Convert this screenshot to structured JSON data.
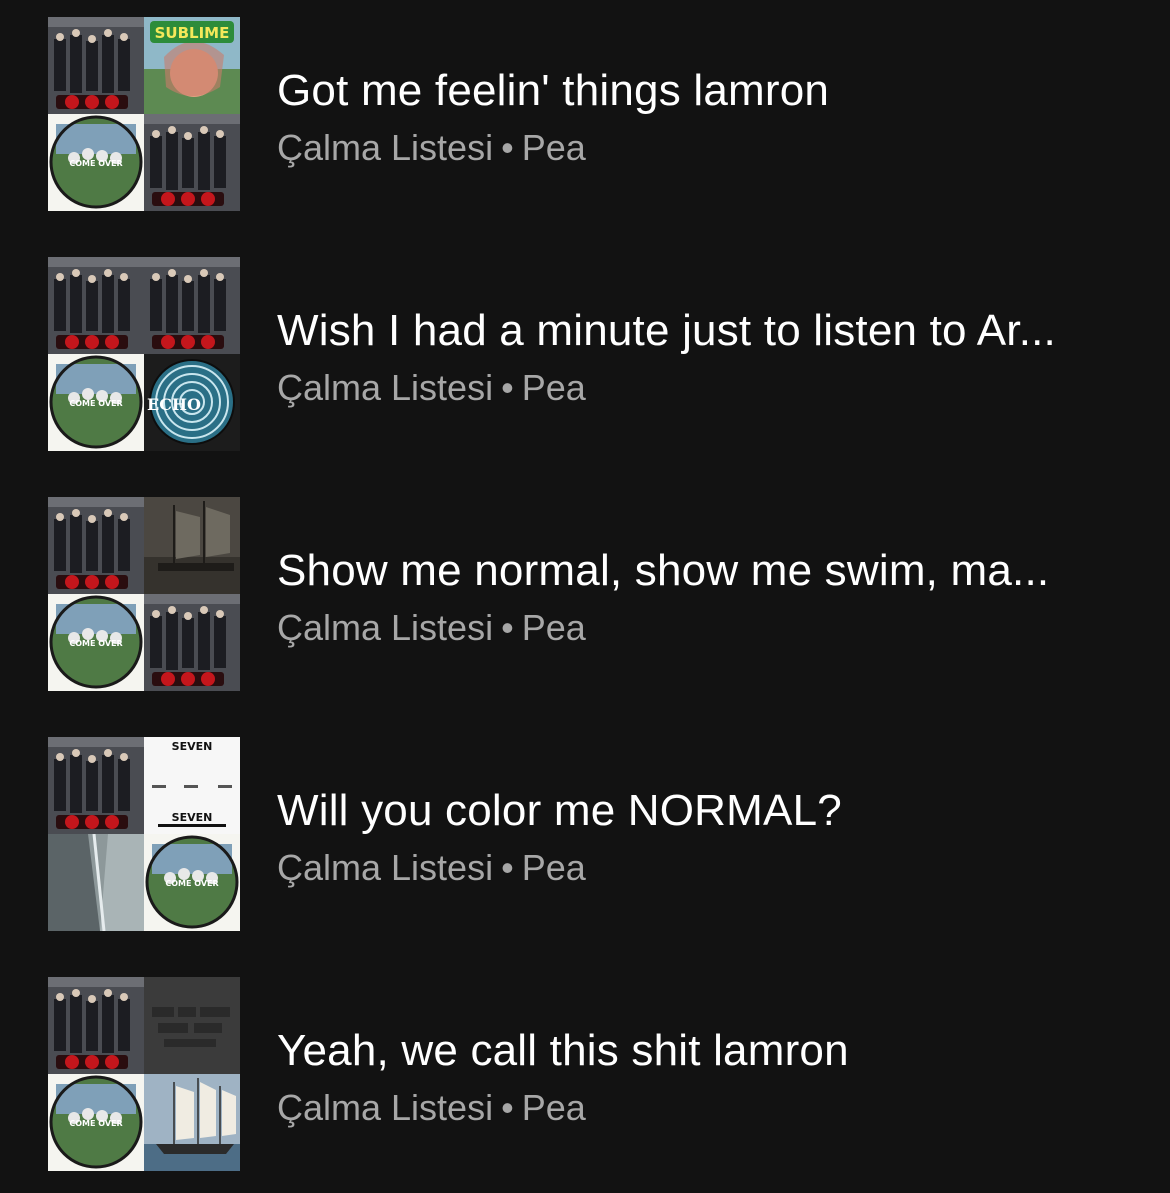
{
  "playlists": [
    {
      "title": "Got me feelin' things lamron",
      "type": "Çalma Listesi",
      "owner": "Pea",
      "covers": [
        "suits-band-cover",
        "sublime-cover",
        "come-over-cover",
        "suits-band-cover"
      ]
    },
    {
      "title": "Wish I had a minute just to listen to Ar...",
      "type": "Çalma Listesi",
      "owner": "Pea",
      "covers": [
        "suits-band-cover",
        "suits-band-cover",
        "come-over-cover",
        "echo-cover"
      ]
    },
    {
      "title": "Show me normal, show me swim, ma...",
      "type": "Çalma Listesi",
      "owner": "Pea",
      "covers": [
        "suits-band-cover",
        "ship-dark-cover",
        "come-over-cover",
        "suits-band-cover"
      ]
    },
    {
      "title": "Will you color me NORMAL?",
      "type": "Çalma Listesi",
      "owner": "Pea",
      "covers": [
        "suits-band-cover",
        "seven-cover",
        "building-cover",
        "come-over-cover"
      ]
    },
    {
      "title": "Yeah, we call this shit lamron",
      "type": "Çalma Listesi",
      "owner": "Pea",
      "covers": [
        "suits-band-cover",
        "dark-text-cover",
        "come-over-cover",
        "sailing-ship-cover"
      ]
    }
  ],
  "separator": "•",
  "cover_texts": {
    "sublime": "SUBLIME",
    "echo": "ECHO",
    "seven": "SEVEN",
    "come_over": "COME OVER"
  }
}
